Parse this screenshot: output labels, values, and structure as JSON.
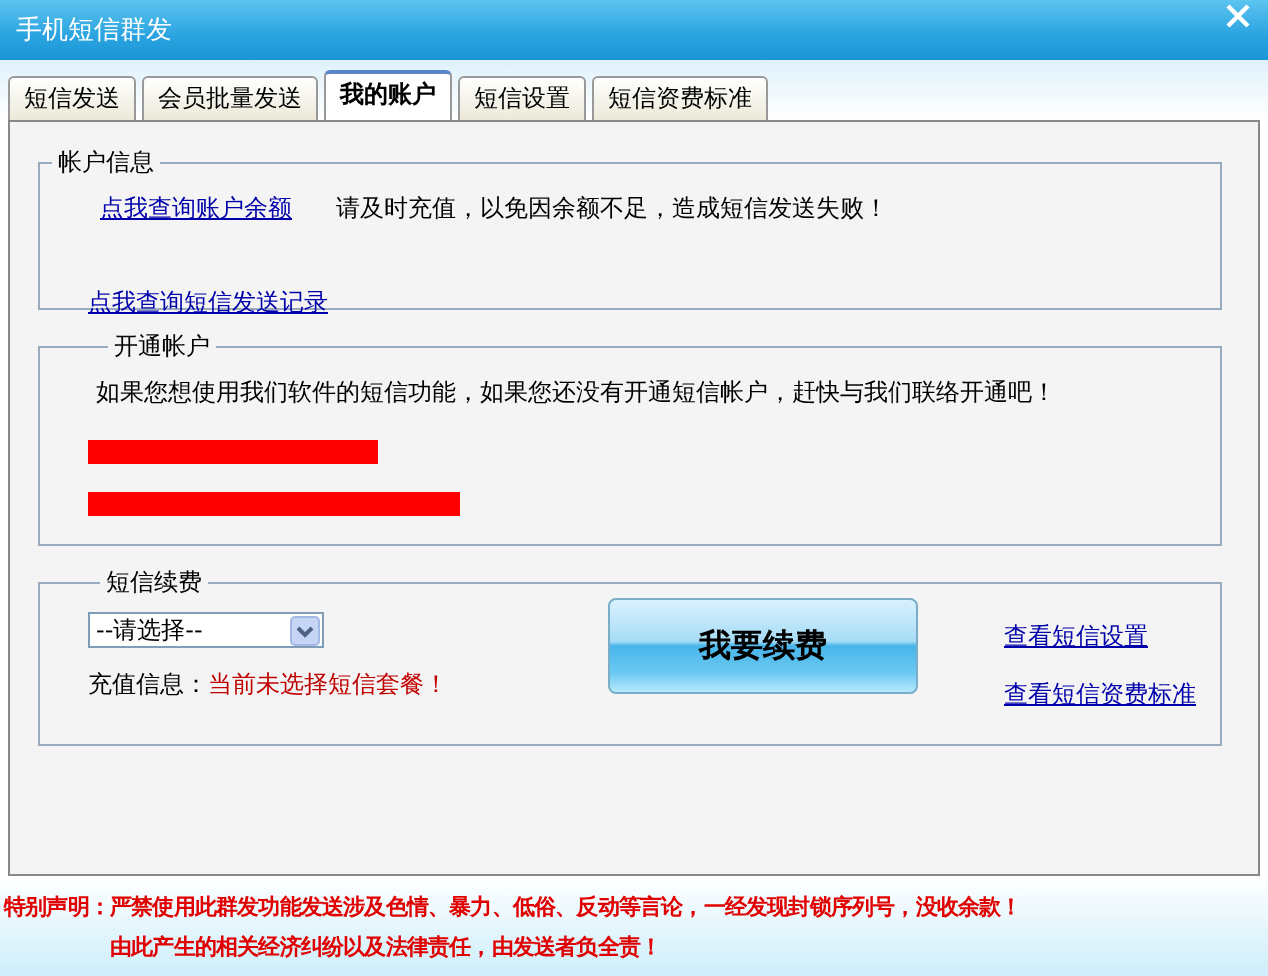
{
  "window": {
    "title": "手机短信群发"
  },
  "tabs": [
    {
      "label": "短信发送",
      "selected": false
    },
    {
      "label": "会员批量发送",
      "selected": false
    },
    {
      "label": "我的账户",
      "selected": true
    },
    {
      "label": "短信设置",
      "selected": false
    },
    {
      "label": "短信资费标准",
      "selected": false
    }
  ],
  "account_info": {
    "legend": "帐户信息",
    "balance_link": "点我查询账户余额",
    "notice": "请及时充值，以免因余额不足，造成短信发送失败！",
    "history_link": "点我查询短信发送记录"
  },
  "open_account": {
    "legend": "开通帐户",
    "message": "如果您想使用我们软件的短信功能，如果您还没有开通短信帐户，赶快与我们联络开通吧！"
  },
  "renewal": {
    "legend": "短信续费",
    "package_select": {
      "value": "--请选择--"
    },
    "info_label": "充值信息：",
    "info_status": "当前未选择短信套餐！",
    "renew_button": "我要续费",
    "links": [
      "查看短信设置",
      "查看短信资费标准"
    ]
  },
  "disclaimer": {
    "label": "特别声明：",
    "lines": [
      "严禁使用此群发功能发送涉及色情、暴力、低俗、反动等言论，一经发现封锁序列号，没收余款！",
      "由此产生的相关经济纠纷以及法律责任，由发送者负全责！"
    ]
  }
}
